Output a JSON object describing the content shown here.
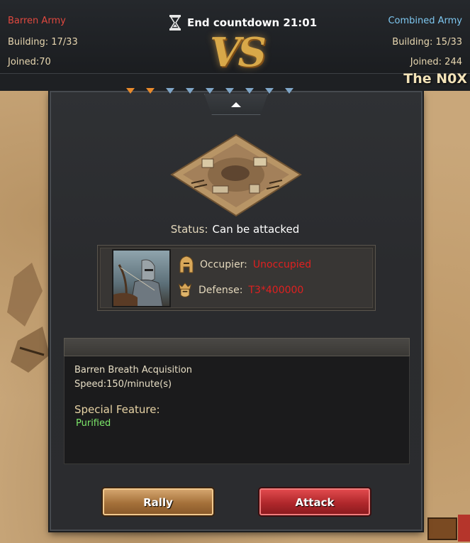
{
  "versus": {
    "left": {
      "name": "Barren Army",
      "building": "Building: 17/33",
      "joined": "Joined:70",
      "color": "#e0483f"
    },
    "right": {
      "name": "Combined Army",
      "building": "Building:  15/33",
      "joined": "Joined: 244",
      "color": "#7ec7f0"
    },
    "countdown": "End countdown 21:01",
    "vs_label": "VS",
    "alliance_name": "The N0X",
    "markers": [
      "done",
      "done",
      "pending",
      "pending",
      "pending",
      "pending",
      "pending",
      "pending",
      "pending"
    ]
  },
  "target": {
    "status_label": "Status:",
    "status_value": "Can be attacked",
    "occupier_label": "Occupier:",
    "occupier_value": "Unoccupied",
    "defense_label": "Defense:",
    "defense_value": "T3*400000"
  },
  "description": {
    "title": "Barren Breath Acquisition",
    "speed": "Speed:150/minute(s)",
    "feature_title": "Special Feature:",
    "feature_value": "Purified"
  },
  "actions": {
    "rally_label": "Rally",
    "attack_label": "Attack"
  },
  "icons": {
    "countdown": "hourglass-icon",
    "occupier": "helmet-icon",
    "defense": "crowned-helmet-icon",
    "collapse": "chevron-up-icon"
  },
  "colors": {
    "warning_red": "#e02020",
    "feature_green": "#7de86a",
    "rally_brown": "#a5713a",
    "attack_red": "#b0282c"
  }
}
